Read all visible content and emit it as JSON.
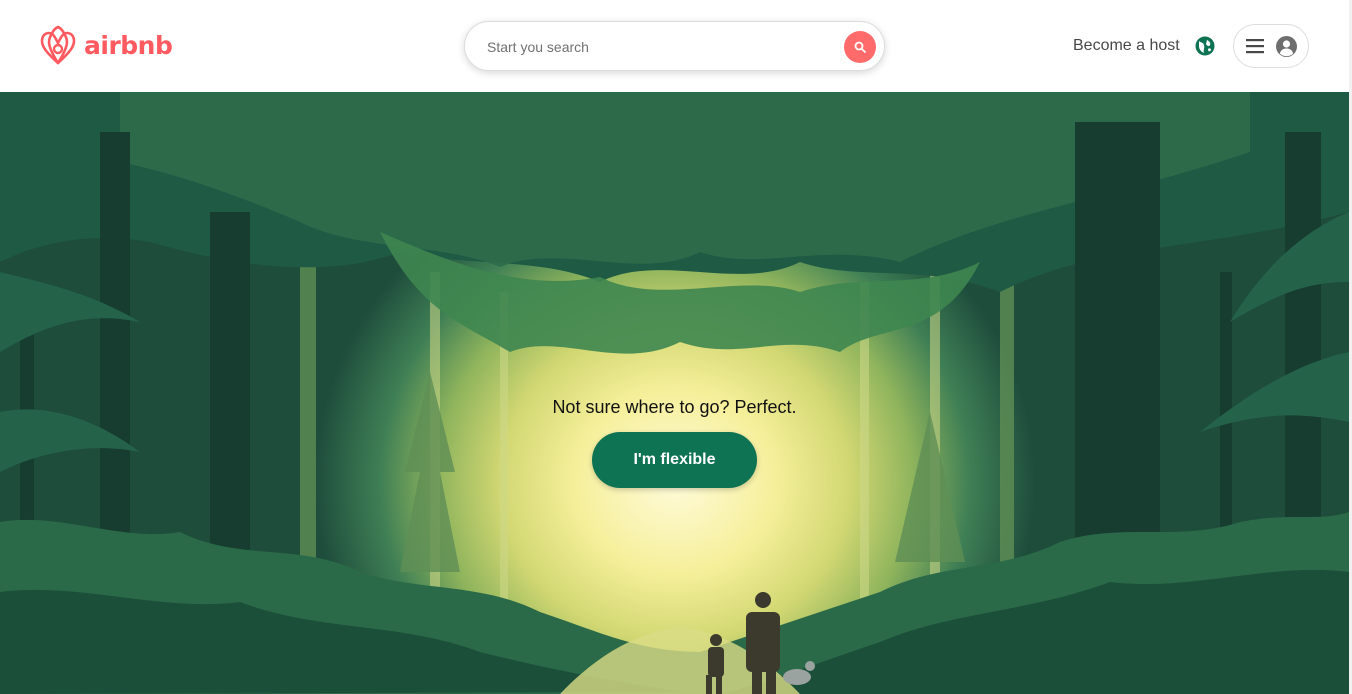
{
  "header": {
    "logo_text": "airbnb",
    "search": {
      "placeholder": "Start you search"
    },
    "become_host_label": "Become a host"
  },
  "hero": {
    "tagline": "Not sure where to go? Perfect.",
    "flexible_button_label": "I'm flexible"
  },
  "icons": {
    "logo": "airbnb-logo-icon",
    "search": "search-icon",
    "globe": "globe-icon",
    "menu": "hamburger-menu-icon",
    "user": "user-avatar-icon"
  },
  "colors": {
    "brand": "#ff5a5f",
    "search_button": "#ff6b6b",
    "primary_button": "#0d7353",
    "globe": "#0d7353",
    "text": "#484848"
  }
}
